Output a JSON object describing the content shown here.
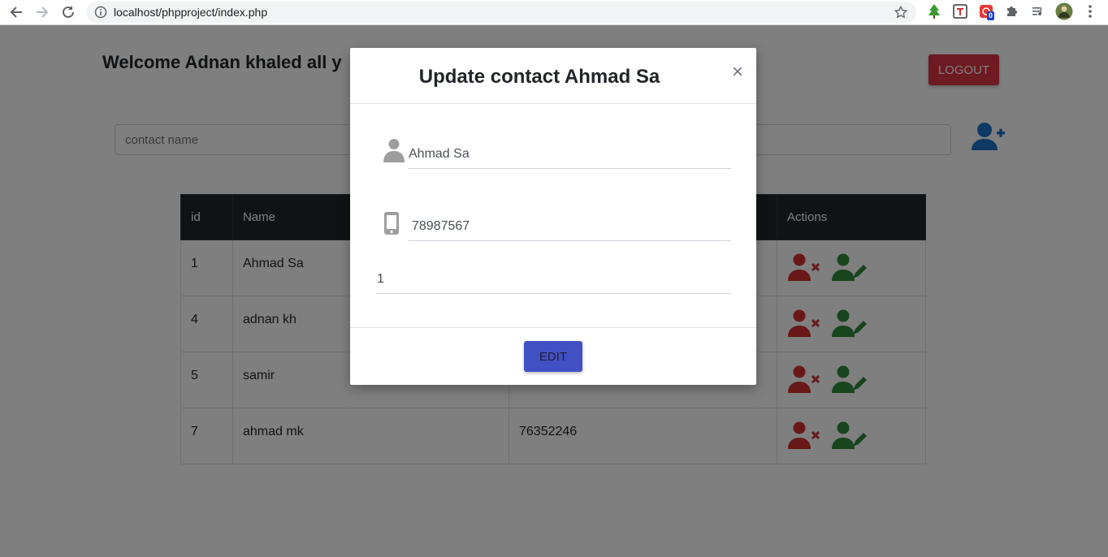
{
  "browser": {
    "url": "localhost/phpproject/index.php",
    "extension_badge": "0",
    "icons": [
      "back-arrow-icon",
      "forward-arrow-icon",
      "reload-icon",
      "info-icon",
      "bookmark-star-icon",
      "extensions-puzzle-icon",
      "media-queue-icon",
      "profile-avatar",
      "menu-dots-icon"
    ]
  },
  "page": {
    "welcome": "Welcome Adnan khaled all y",
    "logout_label": "LOGOUT",
    "search_placeholder": "contact name",
    "table": {
      "headers": {
        "id": "id",
        "name": "Name",
        "phone": "",
        "actions": "Actions"
      },
      "rows": [
        {
          "id": "1",
          "name": "Ahmad Sa",
          "phone": ""
        },
        {
          "id": "4",
          "name": "adnan kh",
          "phone": ""
        },
        {
          "id": "5",
          "name": "samir",
          "phone": ""
        },
        {
          "id": "7",
          "name": "ahmad mk",
          "phone": "76352246"
        }
      ]
    },
    "colors": {
      "danger": "#dc3545",
      "success": "#28a745",
      "primary_icon": "#1a73c8",
      "table_head": "#212529"
    }
  },
  "modal": {
    "title": "Update contact Ahmad Sa",
    "close": "×",
    "name_value": "Ahmad Sa",
    "phone_value": "78987567",
    "id_value": "1",
    "edit_label": "EDIT",
    "button_color": "#4151c4"
  }
}
